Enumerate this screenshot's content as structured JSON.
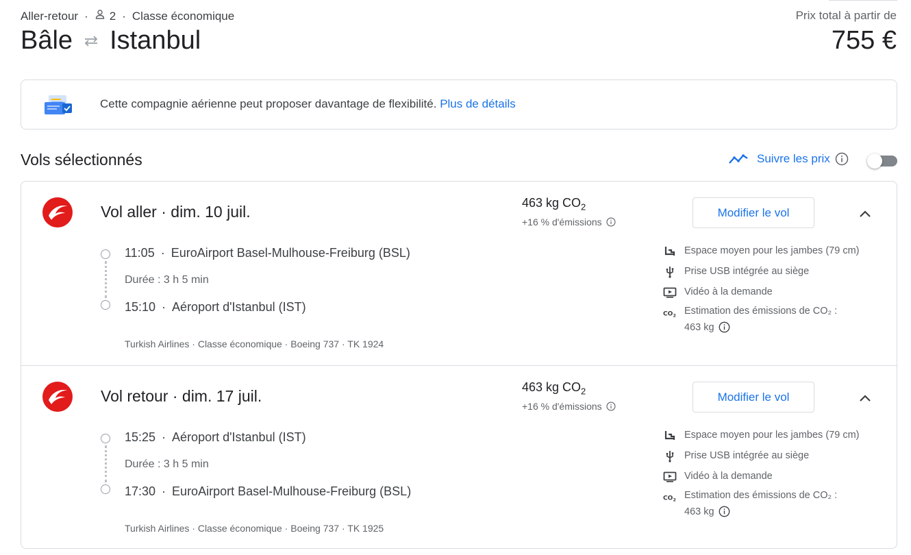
{
  "header": {
    "trip_type": "Aller-retour",
    "passengers": "2",
    "cabin_class": "Classe économique",
    "origin": "Bâle",
    "destination": "Istanbul",
    "price_label": "Prix total à partir de",
    "price": "755 €"
  },
  "banner": {
    "text": "Cette compagnie aérienne peut proposer davantage de flexibilité.",
    "link": "Plus de détails"
  },
  "section": {
    "title": "Vols sélectionnés",
    "track_prices": "Suivre les prix",
    "toggle_on": false
  },
  "flights": [
    {
      "title": "Vol aller",
      "date": "dim. 10 juil.",
      "co2": "463 kg CO",
      "co2_sub": "2",
      "emissions": "+16 % d'émissions",
      "modify": "Modifier le vol",
      "dep_time": "11:05",
      "dep_airport": "EuroAirport Basel-Mulhouse-Freiburg (BSL)",
      "duration": "Durée : 3 h 5 min",
      "arr_time": "15:10",
      "arr_airport": "Aéroport d'Istanbul (IST)",
      "carrier": "Turkish Airlines · Classe économique · Boeing 737 · TK 1924",
      "amenities": {
        "legroom": "Espace moyen pour les jambes (79 cm)",
        "usb": "Prise USB intégrée au siège",
        "video": "Vidéo à la demande",
        "co2_estimate": "Estimation des émissions de CO₂ :",
        "co2_value": "463 kg"
      }
    },
    {
      "title": "Vol retour",
      "date": "dim. 17 juil.",
      "co2": "463 kg CO",
      "co2_sub": "2",
      "emissions": "+16 % d'émissions",
      "modify": "Modifier le vol",
      "dep_time": "15:25",
      "dep_airport": "Aéroport d'Istanbul (IST)",
      "duration": "Durée : 3 h 5 min",
      "arr_time": "17:30",
      "arr_airport": "EuroAirport Basel-Mulhouse-Freiburg (BSL)",
      "carrier": "Turkish Airlines · Classe économique · Boeing 737 · TK 1925",
      "amenities": {
        "legroom": "Espace moyen pour les jambes (79 cm)",
        "usb": "Prise USB intégrée au siège",
        "video": "Vidéo à la demande",
        "co2_estimate": "Estimation des émissions de CO₂ :",
        "co2_value": "463 kg"
      }
    }
  ],
  "colors": {
    "accent": "#1a73e8",
    "airline_red": "#e21b1b",
    "border": "#dadce0"
  },
  "icons": [
    "person-icon",
    "swap-arrows-icon",
    "ticket-flex-icon",
    "trend-icon",
    "info-icon",
    "airline-logo-icon",
    "chevron-up-icon",
    "legroom-icon",
    "usb-icon",
    "video-icon",
    "co2-icon"
  ]
}
